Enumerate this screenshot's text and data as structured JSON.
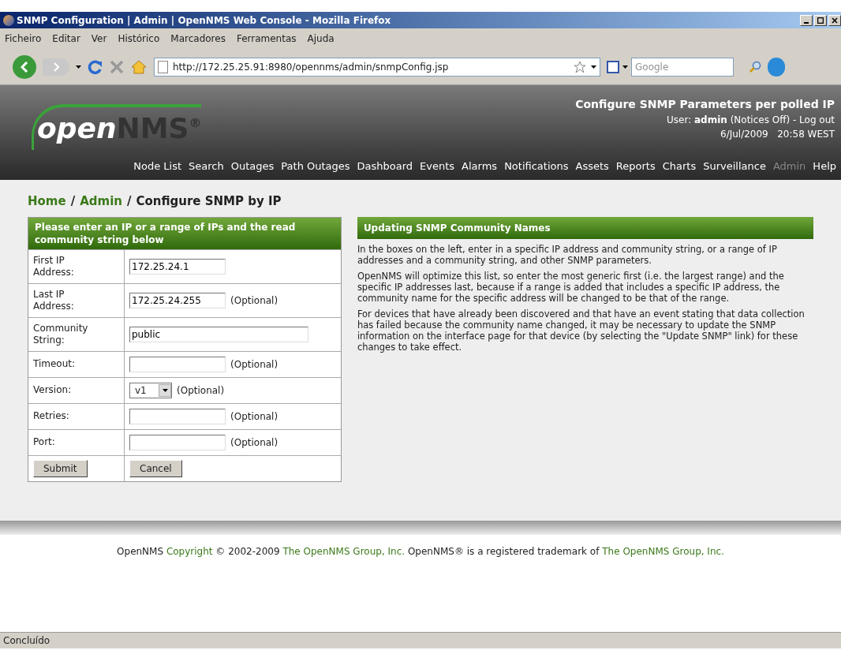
{
  "window": {
    "title": "SNMP Configuration | Admin | OpenNMS Web Console - Mozilla Firefox"
  },
  "menu": [
    "Ficheiro",
    "Editar",
    "Ver",
    "Histórico",
    "Marcadores",
    "Ferramentas",
    "Ajuda"
  ],
  "toolbar": {
    "url": "http://172.25.25.91:8980/opennms/admin/snmpConfig.jsp",
    "search_placeholder": "Google"
  },
  "header": {
    "logo": {
      "part_1": "open",
      "part_2": "NMS",
      "mark": "®"
    },
    "title": "Configure SNMP Parameters per polled IP",
    "user_line": "User: **admin** (Notices Off) - Log out",
    "datetime": "6/Jul/2009   20:58 WEST",
    "nav": [
      {
        "label": "Node List",
        "disabled": false
      },
      {
        "label": "Search",
        "disabled": false
      },
      {
        "label": "Outages",
        "disabled": false
      },
      {
        "label": "Path Outages",
        "disabled": false
      },
      {
        "label": "Dashboard",
        "disabled": false
      },
      {
        "label": "Events",
        "disabled": false
      },
      {
        "label": "Alarms",
        "disabled": false
      },
      {
        "label": "Notifications",
        "disabled": false
      },
      {
        "label": "Assets",
        "disabled": false
      },
      {
        "label": "Reports",
        "disabled": false
      },
      {
        "label": "Charts",
        "disabled": false
      },
      {
        "label": "Surveillance",
        "disabled": false
      },
      {
        "label": "Admin",
        "disabled": true
      },
      {
        "label": "Help",
        "disabled": false
      }
    ]
  },
  "breadcrumb": [
    {
      "label": "Home",
      "kind": "link"
    },
    {
      "label": "/",
      "kind": "sep"
    },
    {
      "label": "Admin",
      "kind": "link"
    },
    {
      "label": "/",
      "kind": "sep"
    },
    {
      "label": "Configure SNMP by IP",
      "kind": "current"
    }
  ],
  "form": {
    "title": "Please enter an IP or a range of IPs and the read community string below",
    "rows": [
      {
        "label": "First IP Address:",
        "kind": "text",
        "value": "172.25.24.1"
      },
      {
        "label": "Last IP Address:",
        "kind": "text",
        "value": "172.25.24.255",
        "note": "(Optional)"
      },
      {
        "label": "Community String:",
        "kind": "wide",
        "value": "public"
      },
      {
        "label": "Timeout:",
        "kind": "text",
        "note": "(Optional)"
      },
      {
        "label": "Version:",
        "kind": "select",
        "value": "v1",
        "note": "(Optional)"
      },
      {
        "label": "Retries:",
        "kind": "text",
        "note": "(Optional)"
      },
      {
        "label": "Port:",
        "kind": "text",
        "note": "(Optional)"
      }
    ],
    "buttons": [
      "Submit",
      "Cancel"
    ]
  },
  "help": {
    "title": "Updating SNMP Community Names",
    "paragraphs": [
      "In the boxes on the left, enter in a specific IP address and community string, or a range of IP addresses and a community string, and other SNMP parameters.",
      "OpenNMS will optimize this list, so enter the most generic first (i.e. the largest range) and the specific IP addresses last, because if a range is added that includes a specific IP address, the community name for the specific address will be changed to be that of the range.",
      "For devices that have already been discovered and that have an event stating that data collection has failed because the community name changed, it may be necessary to update the SNMP information on the interface page for that device (by selecting the \"Update SNMP\" link) for these changes to take effect."
    ]
  },
  "footer": [
    {
      "text": "OpenNMS",
      "kind": "text"
    },
    {
      "text": "Copyright",
      "kind": "link"
    },
    {
      "text": "© 2002-2009",
      "kind": "text"
    },
    {
      "text": "The OpenNMS Group, Inc.",
      "kind": "link"
    },
    {
      "text": "OpenNMS® is a registered trademark of",
      "kind": "text"
    },
    {
      "text": "The OpenNMS Group, Inc.",
      "kind": "link"
    }
  ],
  "status_bar": {
    "text": "Concluído"
  }
}
